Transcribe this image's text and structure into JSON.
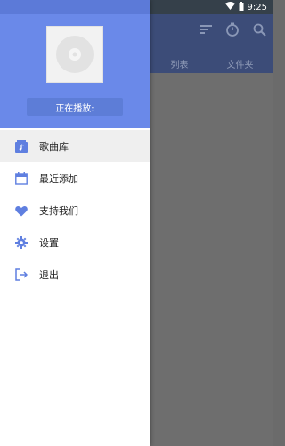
{
  "status_bar": {
    "time": "9:25"
  },
  "app": {
    "tabs": [
      "列表",
      "文件夹"
    ],
    "icons": [
      "sort-icon",
      "timer-icon",
      "search-icon"
    ]
  },
  "drawer": {
    "now_playing_label": "正在播放:",
    "menu_items": [
      {
        "label": "歌曲库",
        "icon": "library-icon",
        "active": true
      },
      {
        "label": "最近添加",
        "icon": "calendar-icon",
        "active": false
      },
      {
        "label": "支持我们",
        "icon": "heart-icon",
        "active": false
      },
      {
        "label": "设置",
        "icon": "gear-icon",
        "active": false
      },
      {
        "label": "退出",
        "icon": "exit-icon",
        "active": false
      }
    ]
  },
  "colors": {
    "accent": "#6a89e9",
    "icon": "#5f7fe0",
    "dim_overlay": "#6e6e6e"
  }
}
